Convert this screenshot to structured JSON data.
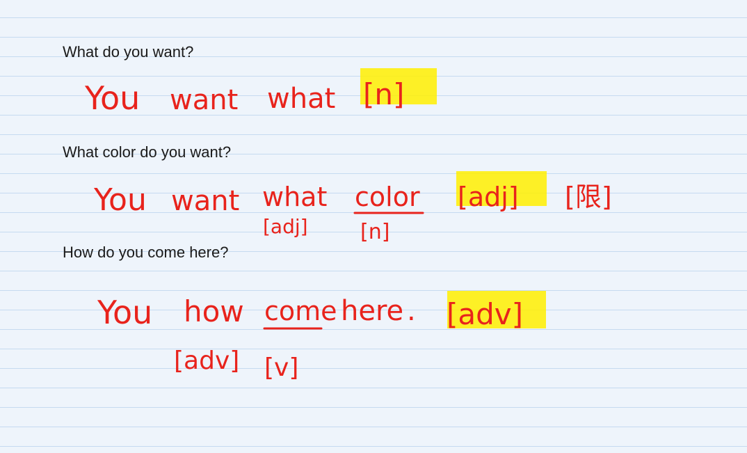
{
  "notes": {
    "q1": {
      "question": "What do you want?",
      "answer_words": [
        "You",
        "want",
        "what"
      ],
      "tag": "[n]",
      "tag_highlighted": true
    },
    "q2": {
      "question": "What color do you want?",
      "answer_words": [
        "You",
        "want",
        "what",
        "color"
      ],
      "tag": "[adj]",
      "tag_highlighted": true,
      "extra_tag": "[限]",
      "sub_tags": [
        "[adj]",
        "[n]"
      ]
    },
    "q3": {
      "question": "How do you come here?",
      "answer_words": [
        "You",
        "how",
        "come",
        "here",
        "."
      ],
      "tag": "[adv]",
      "tag_highlighted": true,
      "sub_tags": [
        "[adv]",
        "[v]"
      ]
    }
  },
  "colors": {
    "ink": "#e8231c",
    "highlight": "#ffee00",
    "rule_line": "#c5daf0",
    "paper": "#eef4fb"
  }
}
